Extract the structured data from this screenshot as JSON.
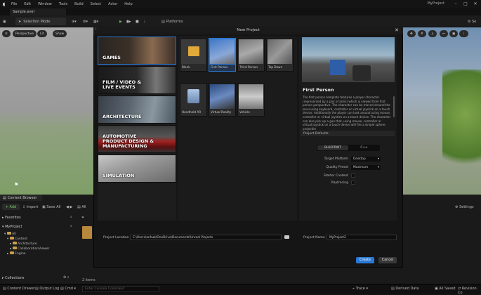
{
  "menu": {
    "items": [
      "File",
      "Edit",
      "Window",
      "Tools",
      "Build",
      "Select",
      "Actor",
      "Help"
    ],
    "project_name": "MyProject"
  },
  "tab": {
    "label": "Sample.evel"
  },
  "toolbar": {
    "selection_mode": "Selection Mode",
    "platforms": "Platforms"
  },
  "viewport": {
    "perspective": "Perspective",
    "lit": "Lit",
    "show": "Show"
  },
  "dialog": {
    "title": "New Project",
    "categories": [
      {
        "label": "GAMES"
      },
      {
        "label": "FILM / VIDEO &\nLIVE EVENTS"
      },
      {
        "label": "ARCHITECTURE"
      },
      {
        "label": "AUTOMOTIVE\nPRODUCT DESIGN &\nMANUFACTURING"
      },
      {
        "label": "SIMULATION"
      }
    ],
    "templates": [
      {
        "label": "Blank"
      },
      {
        "label": "First Person"
      },
      {
        "label": "Third Person"
      },
      {
        "label": "Top Down"
      },
      {
        "label": "Handheld AR"
      },
      {
        "label": "Virtual Reality"
      },
      {
        "label": "Vehicle"
      }
    ],
    "details": {
      "title": "First Person",
      "description": "The first person template features a player character (represented by a pair of arms) which is viewed from first person perspective. The character can be moved around the level using keyboard, controller or virtual joystick on a touch device. Additionally the player can look around using mouse, controller or virtual joystick on a touch device. The character can also pick up a gun that, using mouse, controller or virtual joystick on a touch device will fire a simple sphere projectile",
      "section": "Project Defaults",
      "blueprint": "BLUEPRINT",
      "cpp": "C++",
      "target_platform_label": "Target Platform",
      "target_platform": "Desktop",
      "quality_label": "Quality Preset",
      "quality": "Maximum",
      "starter_label": "Starter Content",
      "raytracing_label": "Raytracing"
    },
    "location_label": "Project Location",
    "location_value": "C:\\Users\\anhub\\OneDrive\\Documents\\Unreal Projects",
    "name_label": "Project Name",
    "name_value": "MyProject2",
    "create": "Create",
    "cancel": "Cancel"
  },
  "content_browser": {
    "tab": "Content Browser",
    "add": "+ Add",
    "import": "Import",
    "save_all": "Save All",
    "all": "All",
    "favorites": "Favorites",
    "project": "MyProject",
    "tree": [
      "All",
      "Content",
      "Architecture",
      "CollaborationViewer",
      "Engine"
    ],
    "collections": "Collections",
    "items_count": "2 items",
    "settings": "Settings"
  },
  "statusbar": {
    "content_drawer": "Content Drawer",
    "output_log": "Output Log",
    "cmd": "Cmd",
    "console_placeholder": "Enter Console Command",
    "trace": "Trace",
    "derived_data": "Derived Data",
    "all_saved": "All Saved",
    "revision": "Revision Co"
  },
  "colors": {
    "accent": "#2a78d4",
    "panel": "#1b1b1b"
  }
}
